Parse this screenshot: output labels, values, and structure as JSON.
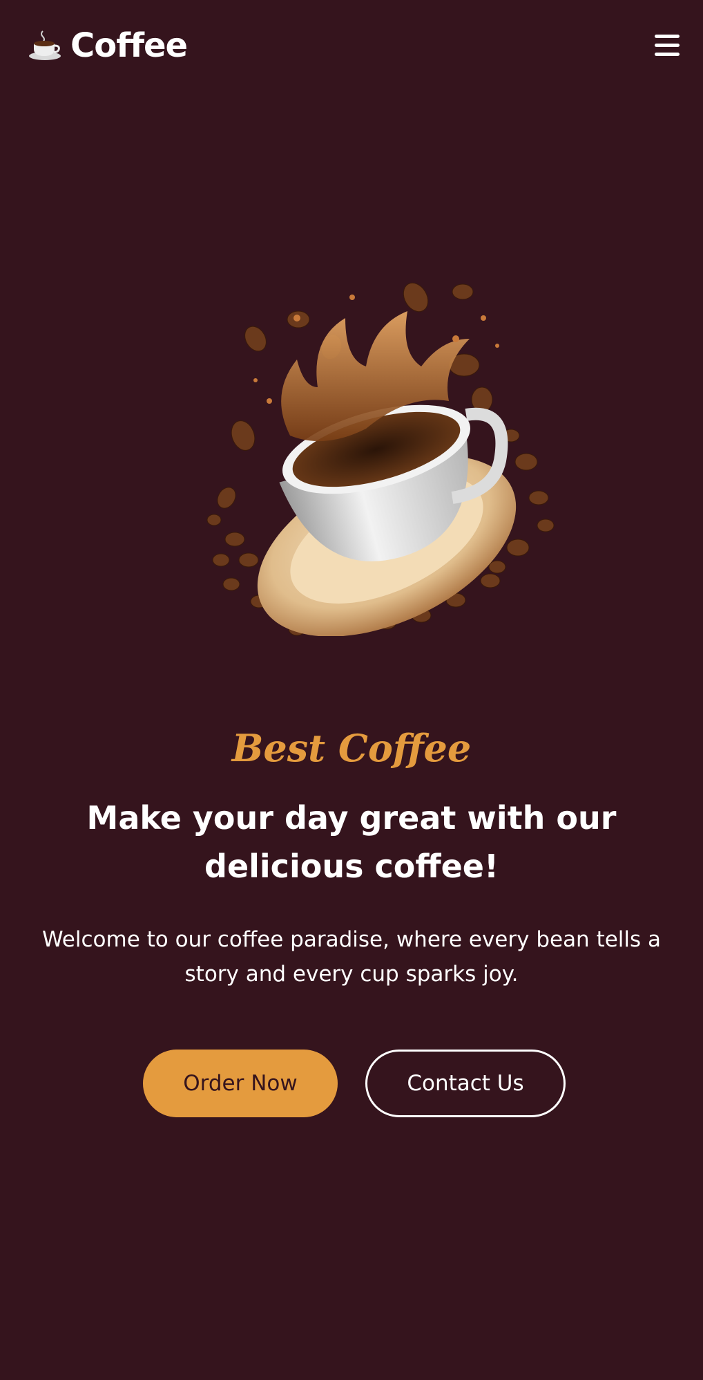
{
  "navbar": {
    "brand_name": "Coffee",
    "brand_icon": "coffee-cup-icon",
    "menu_icon": "hamburger-menu-icon"
  },
  "hero": {
    "image": "coffee-cup-splash-with-beans",
    "tagline": "Best Coffee",
    "headline": "Make your day great with our delicious coffee!",
    "description": "Welcome to our coffee paradise, where every bean tells a story and every cup sparks joy.",
    "primary_button": "Order Now",
    "secondary_button": "Contact Us"
  },
  "colors": {
    "background": "#35141d",
    "accent": "#e49b3e",
    "text": "#ffffff"
  }
}
